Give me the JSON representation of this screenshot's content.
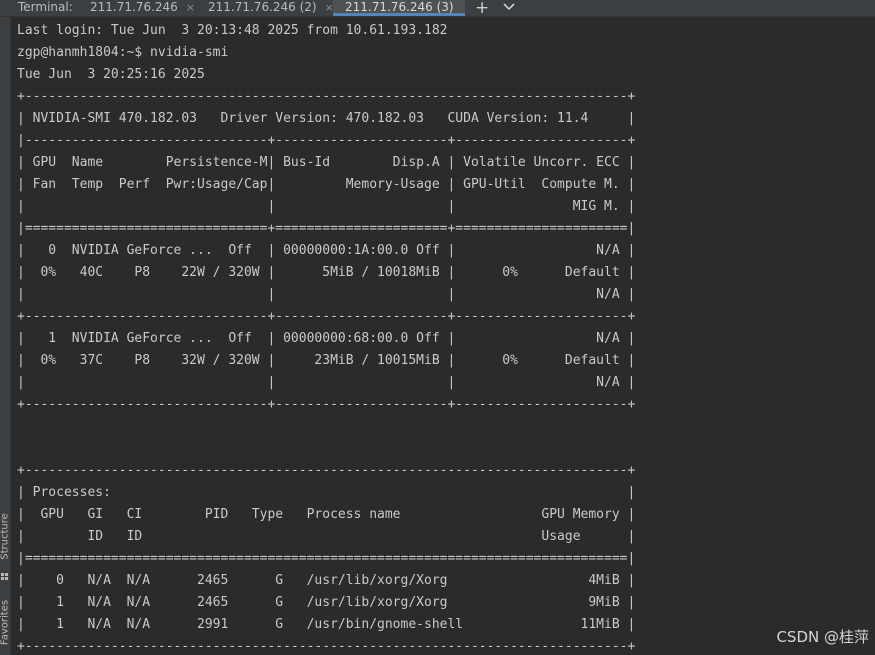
{
  "tabbar": {
    "title": "Terminal:",
    "tabs": [
      {
        "label": "211.71.76.246",
        "close": "×",
        "active": false
      },
      {
        "label": "211.71.76.246 (2)",
        "close": "×",
        "active": false
      },
      {
        "label": "211.71.76.246 (3)",
        "close": "×",
        "active": true
      }
    ],
    "add_label": "+",
    "menu_icon": "chevron-down-icon"
  },
  "left_strip": {
    "structure_label": "Structure",
    "favorites_label": "Favorites"
  },
  "terminal": {
    "lines": [
      "Last login: Tue Jun  3 20:13:48 2025 from 10.61.193.182",
      "zgp@hanmh1804:~$ nvidia-smi",
      "Tue Jun  3 20:25:16 2025",
      "+-----------------------------------------------------------------------------+",
      "| NVIDIA-SMI 470.182.03   Driver Version: 470.182.03   CUDA Version: 11.4     |",
      "|-------------------------------+----------------------+----------------------+",
      "| GPU  Name        Persistence-M| Bus-Id        Disp.A | Volatile Uncorr. ECC |",
      "| Fan  Temp  Perf  Pwr:Usage/Cap|         Memory-Usage | GPU-Util  Compute M. |",
      "|                               |                      |               MIG M. |",
      "|===============================+======================+======================|",
      "|   0  NVIDIA GeForce ...  Off  | 00000000:1A:00.0 Off |                  N/A |",
      "|  0%   40C    P8    22W / 320W |      5MiB / 10018MiB |      0%      Default |",
      "|                               |                      |                  N/A |",
      "+-------------------------------+----------------------+----------------------+",
      "|   1  NVIDIA GeForce ...  Off  | 00000000:68:00.0 Off |                  N/A |",
      "|  0%   37C    P8    32W / 320W |     23MiB / 10015MiB |      0%      Default |",
      "|                               |                      |                  N/A |",
      "+-------------------------------+----------------------+----------------------+",
      "",
      "",
      "+-----------------------------------------------------------------------------+",
      "| Processes:                                                                  |",
      "|  GPU   GI   CI        PID   Type   Process name                  GPU Memory |",
      "|        ID   ID                                                   Usage      |",
      "|=============================================================================|",
      "|    0   N/A  N/A      2465      G   /usr/lib/xorg/Xorg                  4MiB |",
      "|    1   N/A  N/A      2465      G   /usr/lib/xorg/Xorg                  9MiB |",
      "|    1   N/A  N/A      2991      G   /usr/bin/gnome-shell               11MiB |",
      "+-----------------------------------------------------------------------------+"
    ],
    "prompt": "zgp@hanmh1804:~$"
  },
  "watermark": "CSDN @桂萍"
}
